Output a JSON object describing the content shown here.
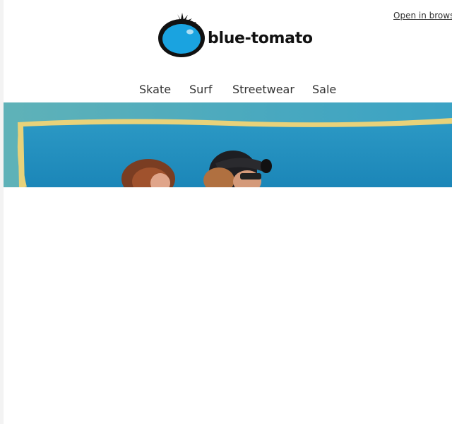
{
  "header": {
    "open_in_browser": "Open in browse"
  },
  "logo": {
    "text": "blue-tomato",
    "icon": "blue-tomato-logo-icon"
  },
  "nav": {
    "items": [
      {
        "label": "Skate"
      },
      {
        "label": "Surf"
      },
      {
        "label": "Streetwear"
      },
      {
        "label": "Sale"
      }
    ]
  },
  "hero": {
    "image": "hero-photo-two-people-blue-wall"
  },
  "colors": {
    "brand_blue": "#1aa3e0",
    "hero_wall": "#1e8fc0",
    "hero_frame": "#e8d27a",
    "text": "#333333"
  }
}
